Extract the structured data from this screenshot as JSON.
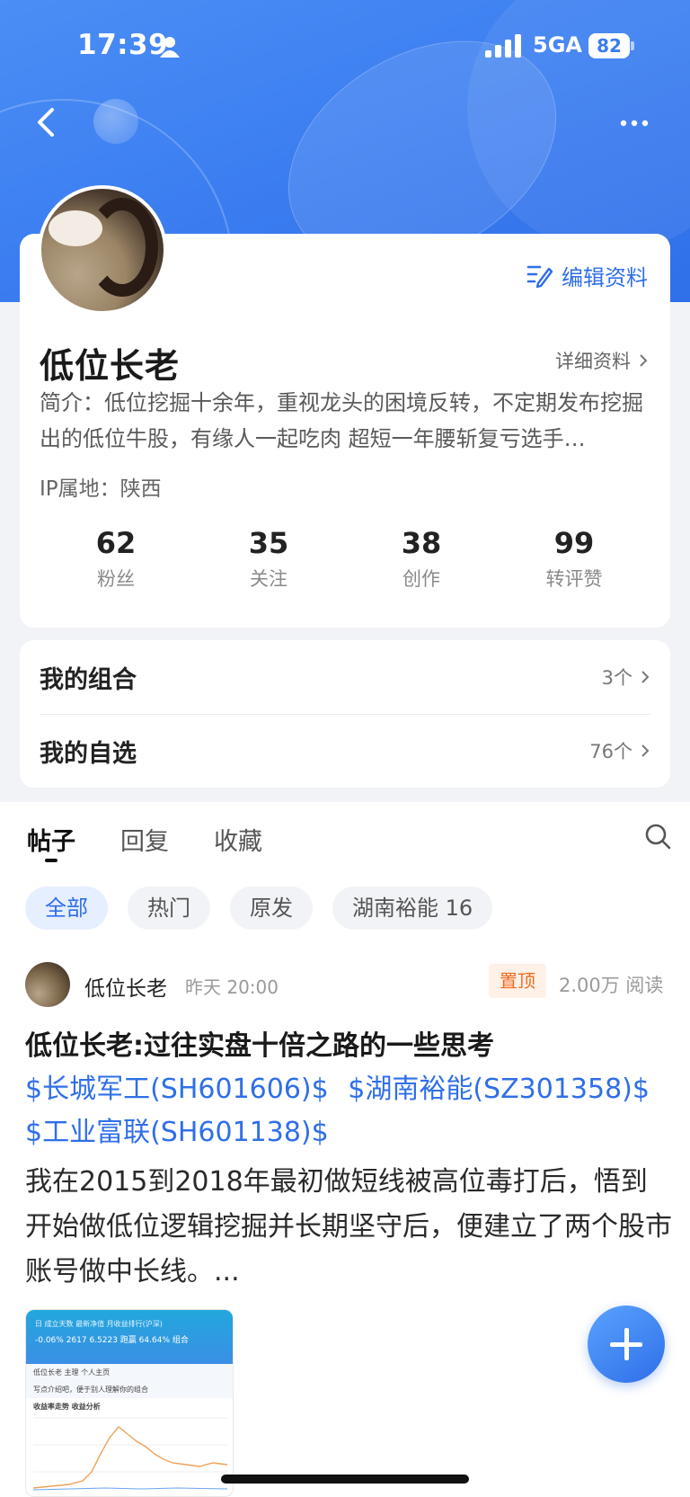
{
  "status_bar": {
    "time": "17:39",
    "network": "5GA",
    "battery": "82"
  },
  "profile": {
    "edit_label": "编辑资料",
    "username": "低位长老",
    "detail_label": "详细资料",
    "bio": "简介：低位挖掘十余年，重视龙头的困境反转，不定期发布挖掘出的低位牛股，有缘人一起吃肉 超短一年腰斩复亏选手…",
    "ip": "IP属地：陕西",
    "stats": [
      {
        "value": "62",
        "label": "粉丝"
      },
      {
        "value": "35",
        "label": "关注"
      },
      {
        "value": "38",
        "label": "创作"
      },
      {
        "value": "99",
        "label": "转评赞"
      }
    ]
  },
  "lists": [
    {
      "title": "我的组合",
      "count": "3个"
    },
    {
      "title": "我的自选",
      "count": "76个"
    }
  ],
  "tabs": [
    "帖子",
    "回复",
    "收藏"
  ],
  "chips": [
    "全部",
    "热门",
    "原发",
    "湖南裕能 16"
  ],
  "post": {
    "author": "低位长老",
    "time": "昨天 20:00",
    "pin": "置顶",
    "reads": "2.00万 阅读",
    "title": "低位长老:过往实盘十倍之路的一些思考",
    "stocks": [
      "$长城军工(SH601606)$",
      "$湖南裕能(SZ301358)$",
      "$工业富联(SH601138)$"
    ],
    "body": "我在2015到2018年最初做短线被高位毒打后，悟到开始做低位逻辑挖掘并长期坚守后，便建立了两个股市账号做中长线。..."
  },
  "thumb": {
    "header": "日 成立天数 最新净值 月收益排行(沪深)",
    "values": "-0.06% 2617 6.5223 跑赢 64.64% 组合",
    "user": "低位长老 主理 个人主页",
    "note": "写点介绍吧，便于别人理解你的组合",
    "chart_title": "收益率走势 收益分析"
  },
  "colors": {
    "accent": "#2f6fe8",
    "pin": "#f06b1f"
  }
}
